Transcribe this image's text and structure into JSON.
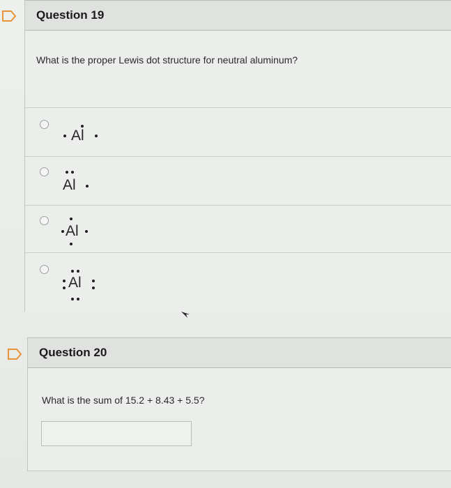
{
  "q19": {
    "title": "Question 19",
    "prompt": "What is the proper Lewis dot structure for neutral aluminum?",
    "options": [
      {
        "symbol": "Al"
      },
      {
        "symbol": "Al"
      },
      {
        "symbol": "Al"
      },
      {
        "symbol": "Al"
      }
    ]
  },
  "q20": {
    "title": "Question 20",
    "prompt": "What is the sum of 15.2 + 8.43 + 5.5?",
    "answer_value": ""
  },
  "icons": {
    "flag": "flag-outline-icon",
    "radio": "radio-unselected",
    "cursor": "mouse-pointer-icon"
  },
  "colors": {
    "flag_orange": "#e8943a",
    "header_bg": "#dfe2df"
  }
}
